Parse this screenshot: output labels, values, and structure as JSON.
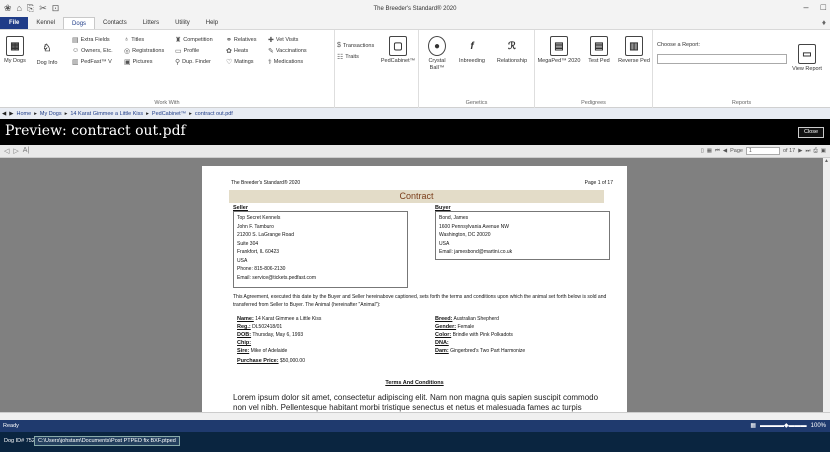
{
  "app": {
    "title": "The Breeder's Standard® 2020",
    "menus": [
      "File",
      "Kennel",
      "Dogs",
      "Contacts",
      "Litters",
      "Utility",
      "Help"
    ],
    "active_menu": "Dogs",
    "window_controls": [
      "–",
      "□"
    ]
  },
  "ribbon": {
    "my_dogs": "My Dogs",
    "dog_info": "Dog Info",
    "work_with": [
      "Extra Fields",
      "Owners, Etc.",
      "PedFast™ V",
      "Titles",
      "Registrations",
      "Pictures",
      "Competition",
      "Profile",
      "Dup. Finder",
      "Relatives",
      "Heats",
      "Matings",
      "Vet Visits",
      "Vaccinations",
      "Medications",
      "Transactions",
      "Traits"
    ],
    "work_with_label": "Work With",
    "pedcabinet": "PedCabinet™",
    "genetics": [
      "Crystal Ball™",
      "Inbreeding",
      "Relationship"
    ],
    "genetics_label": "Genetics",
    "pedigrees": [
      "MegaPed™ 2020",
      "Test Ped",
      "Reverse Ped"
    ],
    "pedigrees_label": "Pedigrees",
    "choose_report": "Choose a Report:",
    "view_report": "View Report",
    "reports_label": "Reports"
  },
  "breadcrumb": [
    "Home",
    "My Dogs",
    "14 Karat Gimmee a Little Kiss",
    "PedCabinet™",
    "contract out.pdf"
  ],
  "preview": {
    "title": "Preview: contract out.pdf",
    "close": "Close",
    "page_label": "Page",
    "page_value": "1",
    "page_of": "of 17"
  },
  "doc": {
    "header_left": "The Breeder's Standard® 2020",
    "header_right": "Page 1 of 17",
    "title": "Contract",
    "seller_label": "Seller",
    "buyer_label": "Buyer",
    "seller": [
      "Top Secret Kennels",
      "John F. Tamburo",
      "21200 S. LaGrange Road",
      "Suite 304",
      "Frankfort, IL 60423",
      "USA",
      "Phone: 815-806-2130",
      "Email: service@tickets.pedfast.com"
    ],
    "buyer": [
      "Bond, James",
      "1600 Pennsylvania Avenue NW",
      "Washington, DC 20020",
      "USA",
      "Email: jamesbond@martini.co.uk"
    ],
    "agreement": "This Agreement, executed this date by the Buyer and Seller hereinabove captioned, sets forth the terms and conditions upon which the animal set forth below is sold and transferred from Seller to Buyer.  The Animal (hereinafter \"Animal\"):",
    "fields_left": [
      {
        "label": "Name:",
        "value": "14 Karat Gimmee a Little Kiss"
      },
      {
        "label": "Reg.:",
        "value": "DL502418/01"
      },
      {
        "label": "DOB:",
        "value": "Thursday, May 6, 1993"
      },
      {
        "label": "Chip:",
        "value": ""
      },
      {
        "label": "Sire:",
        "value": "Mike of Adelaide"
      },
      {
        "label": "Purchase Price:",
        "value": "$50,000.00"
      }
    ],
    "fields_right": [
      {
        "label": "Breed:",
        "value": "Australian Shepherd"
      },
      {
        "label": "Gender:",
        "value": "Female"
      },
      {
        "label": "Color:",
        "value": "Brindle with Pink Polkadots"
      },
      {
        "label": "DNA:",
        "value": ""
      },
      {
        "label": "Dam:",
        "value": "Gingerbred's Two Part Harmonize"
      }
    ],
    "terms_heading": "Terms And Conditions",
    "lorem": "Lorem ipsum dolor sit amet, consectetur adipiscing elit. Nam non magna quis sapien suscipit commodo non vel nibh. Pellentesque habitant morbi tristique senectus et netus et malesuada fames ac turpis"
  },
  "status": {
    "text": "Ready",
    "zoom": "100%"
  },
  "taskbar": {
    "dog_id": "Dog ID# 7526",
    "path": "C:\\Users\\johstam\\Documents\\Post PTPED fix BXF.ptped"
  }
}
